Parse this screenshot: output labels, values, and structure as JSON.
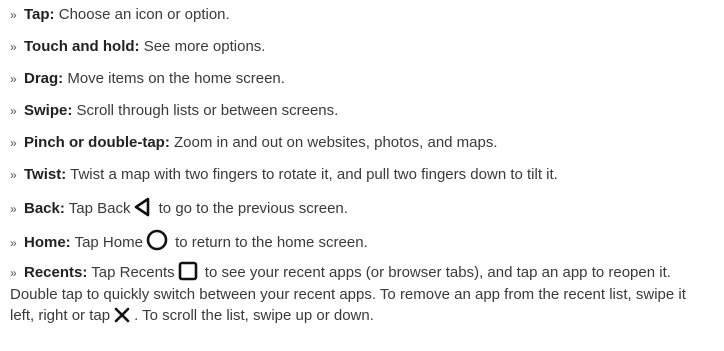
{
  "bullet": "»",
  "items": [
    {
      "term": "Tap:",
      "desc": " Choose an icon or option."
    },
    {
      "term": "Touch and hold:",
      "desc": " See more options."
    },
    {
      "term": "Drag:",
      "desc": " Move items on the home screen."
    },
    {
      "term": "Swipe:",
      "desc": " Scroll through lists or between screens."
    },
    {
      "term": "Pinch or double-tap:",
      "desc": " Zoom in and out on websites, photos, and maps."
    },
    {
      "term": "Twist:",
      "desc": " Twist a map with two fingers to rotate it, and pull two fingers down to tilt it."
    },
    {
      "term": "Back:",
      "desc_before": " Tap Back",
      "icon": "back-triangle-icon",
      "desc_after": " to go to the previous screen."
    },
    {
      "term": "Home:",
      "desc_before": " Tap Home",
      "icon": "home-circle-icon",
      "desc_after": " to return to the home screen."
    },
    {
      "term": "Recents:",
      "desc_before": " Tap Recents",
      "icon": "recents-square-icon",
      "desc_mid": " to see your recent apps (or browser tabs), and tap an app to reopen it. Double tap to quickly switch between your recent apps. To remove an app from the recent list, swipe it left, right or tap",
      "icon2": "close-x-icon",
      "desc_after": ". To scroll the list, swipe up or down."
    }
  ]
}
